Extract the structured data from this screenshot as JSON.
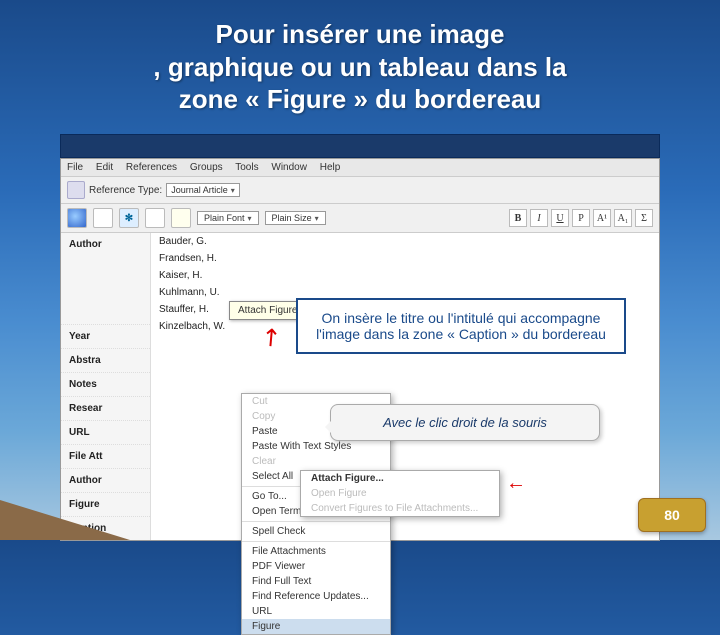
{
  "title": {
    "line1": "Pour  insérer une image",
    "line2": ", graphique ou un  tableau dans la",
    "line3": "zone « Figure » du bordereau"
  },
  "menubar": {
    "file": "File",
    "edit": "Edit",
    "references": "References",
    "groups": "Groups",
    "tools": "Tools",
    "window": "Window",
    "help": "Help"
  },
  "row2": {
    "reftype_label": "Reference Type:",
    "reftype_value": "Journal Article"
  },
  "row3": {
    "plainfont": "Plain Font",
    "plainsize": "Plain Size",
    "fmt_b": "B",
    "fmt_i": "I",
    "fmt_u": "U",
    "fmt_p": "P",
    "fmt_a1": "A¹",
    "fmt_a2": "A₁",
    "fmt_sigma": "Σ"
  },
  "labels": {
    "author": "Author",
    "year": "Year",
    "abstra": "Abstra",
    "notes": "Notes",
    "resear": "Resear",
    "url": "URL",
    "fileatt": "File Att",
    "author2": "Author",
    "figure": "Figure",
    "caption": "Caption"
  },
  "authors": {
    "a1": "Bauder, G.",
    "a2": "Frandsen, H.",
    "a3": "Kaiser, H.",
    "a4": "Kuhlmann, U.",
    "a5": "Stauffer, H.",
    "a6": "Kinzelbach, W."
  },
  "tooltip": {
    "text": "Attach Figure"
  },
  "ctx": {
    "cut": "Cut",
    "copy": "Copy",
    "paste": "Paste",
    "paste_styles": "Paste With Text Styles",
    "clear": "Clear",
    "select_all": "Select All",
    "goto": "Go To...",
    "open_term": "Open Term Lists",
    "spell": "Spell Check",
    "file_attach": "File Attachments",
    "pdf": "PDF Viewer",
    "find_full": "Find Full Text",
    "find_ref": "Find Reference Updates...",
    "url": "URL",
    "figure": "Figure"
  },
  "callout": {
    "text": "On insère le titre ou l'intitulé qui accompagne l'image dans la zone « Caption » du bordereau"
  },
  "speech": {
    "text": "Avec le clic droit de la souris"
  },
  "submenu": {
    "attach": "Attach Figure...",
    "open": "Open Figure",
    "convert": "Convert Figures to File Attachments..."
  },
  "page": {
    "number": "80"
  }
}
